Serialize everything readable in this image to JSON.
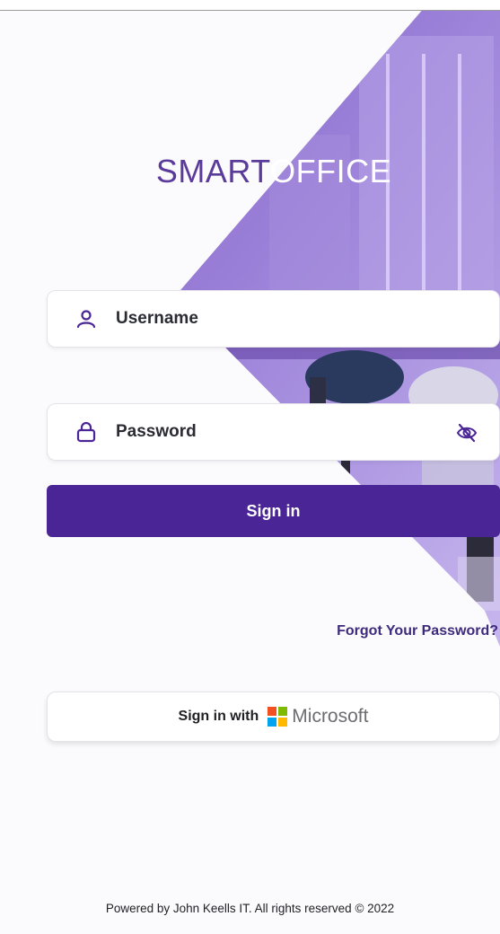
{
  "brand": {
    "logo_part1": "SMART",
    "logo_part2": "OFFICE",
    "logo_color": "#5b3b9a"
  },
  "login": {
    "username_placeholder": "Username",
    "password_placeholder": "Password",
    "username_icon": "user-icon",
    "password_icon": "lock-icon",
    "toggle_icon": "eye-off-icon",
    "signin_label": "Sign in",
    "forgot_label": "Forgot Your Password?",
    "ms_prefix": "Sign in with",
    "ms_brand": "Microsoft",
    "accent": "#4a2596"
  },
  "footer": {
    "text": "Powered by John Keells IT. All rights reserved © 2022"
  }
}
